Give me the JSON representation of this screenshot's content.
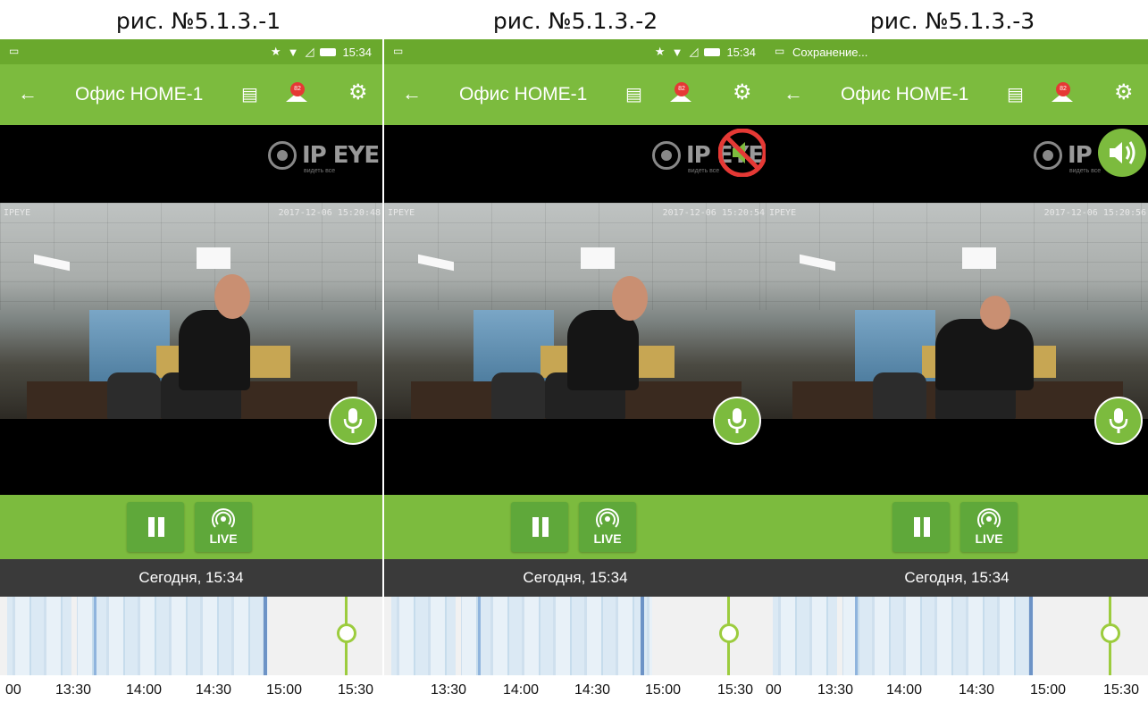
{
  "captions": [
    "рис. №5.1.3.-1",
    "рис. №5.1.3.-2",
    "рис. №5.1.3.-3"
  ],
  "status_bar": {
    "time": "15:34",
    "saving_text": "Сохранение..."
  },
  "app_bar": {
    "back_icon": "arrow-left-icon",
    "title": "Офис HOME-1",
    "calendar_icon": "calendar-icon",
    "alarm_badge": "82",
    "settings_icon": "gear-icon"
  },
  "video": {
    "logo_text": "IP EYE",
    "logo_sub": "видеть все",
    "osd_label": "IPEYE",
    "osd_timestamps": [
      "2017-12-06 15:20:48",
      "2017-12-06 15:20:54",
      "2017-12-06 15:20:56"
    ],
    "mic_icon": "microphone-icon",
    "sound_states": [
      "none",
      "muted",
      "on"
    ]
  },
  "controls": {
    "pause_icon": "pause-icon",
    "live_label": "LIVE"
  },
  "date_label": "Сегодня, 15:34",
  "timeline": {
    "tick_labels": [
      "00",
      "13:30",
      "14:00",
      "14:30",
      "15:00",
      "15:30"
    ],
    "tick_labels_panel3": [
      "00",
      "13:30",
      "14:00",
      "14:30",
      "15:00",
      "15:30"
    ]
  },
  "colors": {
    "green": "#7cbb3e",
    "status_green": "#6aa92d",
    "mute_red": "#e53935",
    "pointer": "#9ccc3e"
  }
}
